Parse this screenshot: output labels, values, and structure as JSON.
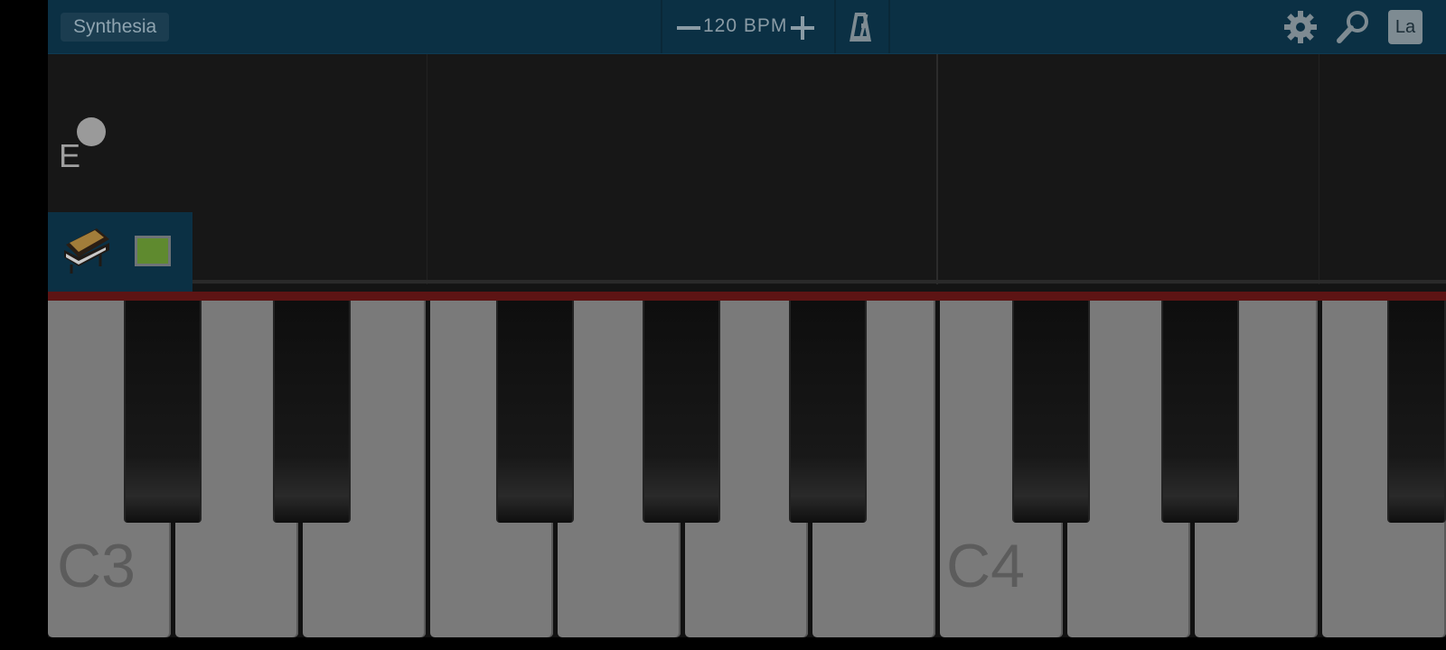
{
  "toolbar": {
    "app_button_label": "Synthesia",
    "bpm_label": "120 BPM",
    "language_button_label": "La",
    "icons": [
      "minus-icon",
      "plus-icon",
      "metronome-icon",
      "gear-icon",
      "search-icon"
    ]
  },
  "notes": {
    "current_note": "E"
  },
  "instrument": {
    "icon": "grand-piano-icon",
    "track_color": "#5f8a2f"
  },
  "keyboard": {
    "labels": {
      "c3": "C3",
      "c4": "C4"
    }
  },
  "colors": {
    "topbar": "#0b3044",
    "red_strip": "#5d1414",
    "white_key": "#7a7a7a"
  }
}
